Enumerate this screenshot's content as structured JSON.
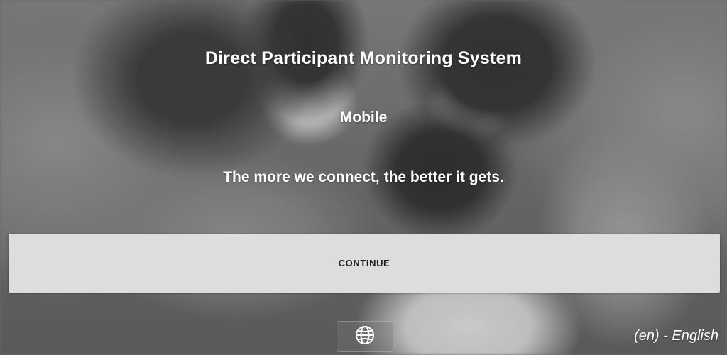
{
  "app": {
    "title": "Direct Participant Monitoring System",
    "subtitle": "Mobile",
    "tagline": "The more we connect, the better it gets."
  },
  "actions": {
    "continue_label": "CONTINUE"
  },
  "language": {
    "icon": "globe-icon",
    "current": "(en) - English"
  }
}
